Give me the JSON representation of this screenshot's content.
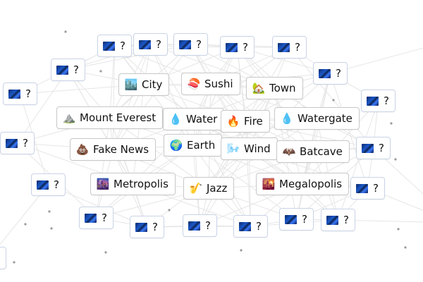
{
  "elements": [
    {
      "label": "City",
      "emoji": "🏙️",
      "known": true
    },
    {
      "label": "Sushi",
      "emoji": "🍣",
      "known": true
    },
    {
      "label": "Town",
      "emoji": "🏡",
      "known": true
    },
    {
      "label": "Mount Everest",
      "emoji": "⛰️",
      "known": true
    },
    {
      "label": "Water",
      "emoji": "💧",
      "known": true
    },
    {
      "label": "Fire",
      "emoji": "🔥",
      "known": true
    },
    {
      "label": "Watergate",
      "emoji": "💧",
      "known": true
    },
    {
      "label": "Fake News",
      "emoji": "💩",
      "known": true
    },
    {
      "label": "Earth",
      "emoji": "🌍",
      "known": true
    },
    {
      "label": "Wind",
      "emoji": "🌬️",
      "known": true
    },
    {
      "label": "Batcave",
      "emoji": "🦇",
      "known": true
    },
    {
      "label": "Metropolis",
      "emoji": "🌆",
      "known": true
    },
    {
      "label": "Jazz",
      "emoji": "🎷",
      "known": true
    },
    {
      "label": "Megalopolis",
      "emoji": "🌇",
      "known": true
    },
    {
      "label": "?",
      "emoji": "",
      "known": false
    },
    {
      "label": "?",
      "emoji": "",
      "known": false
    },
    {
      "label": "?",
      "emoji": "",
      "known": false
    },
    {
      "label": "?",
      "emoji": "",
      "known": false
    },
    {
      "label": "?",
      "emoji": "",
      "known": false
    },
    {
      "label": "?",
      "emoji": "",
      "known": false
    },
    {
      "label": "?",
      "emoji": "",
      "known": false
    },
    {
      "label": "?",
      "emoji": "",
      "known": false
    },
    {
      "label": "?",
      "emoji": "",
      "known": false
    },
    {
      "label": "?",
      "emoji": "",
      "known": false
    },
    {
      "label": "?",
      "emoji": "",
      "known": false
    },
    {
      "label": "?",
      "emoji": "",
      "known": false
    },
    {
      "label": "?",
      "emoji": "",
      "known": false
    },
    {
      "label": "?",
      "emoji": "",
      "known": false
    },
    {
      "label": "?",
      "emoji": "",
      "known": false
    },
    {
      "label": "?",
      "emoji": "",
      "known": false
    },
    {
      "label": "?",
      "emoji": "",
      "known": false
    },
    {
      "label": "?",
      "emoji": "",
      "known": false
    },
    {
      "label": "?",
      "emoji": "",
      "known": false
    },
    {
      "label": "?",
      "emoji": "",
      "known": false
    },
    {
      "label": "?",
      "emoji": "",
      "known": false
    },
    {
      "label": "?",
      "emoji": "",
      "known": false
    }
  ],
  "colors": {
    "background": "#ffffff",
    "edge": "#e6e6e6",
    "border": "#c8c8c8",
    "dot": "#9a9a9a"
  }
}
